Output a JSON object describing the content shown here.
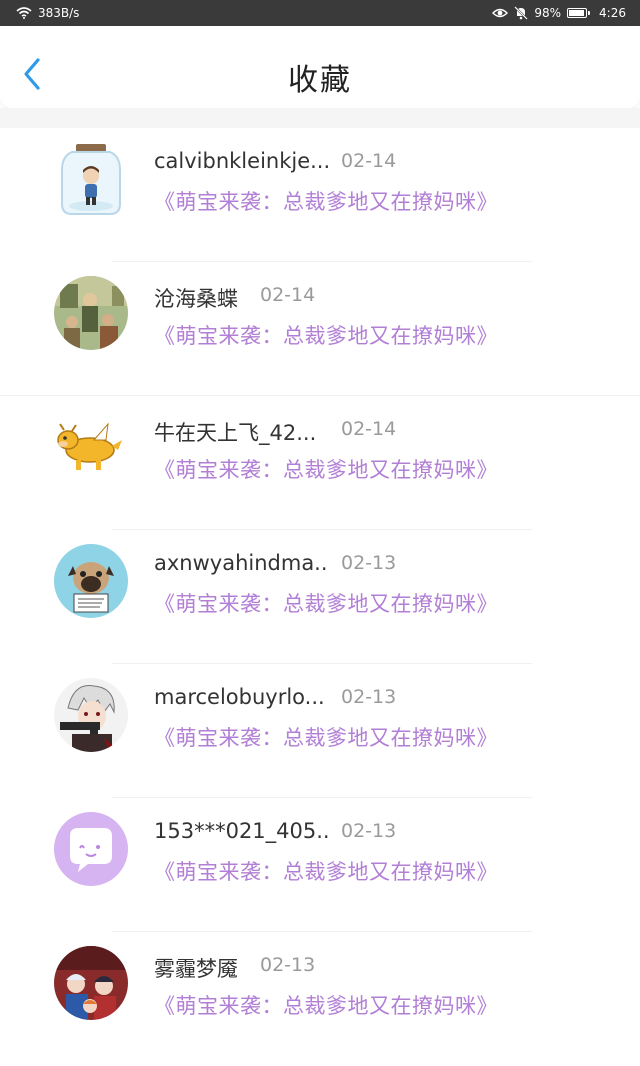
{
  "status_bar": {
    "speed": "383B/s",
    "battery": "98%",
    "time": "4:26"
  },
  "header": {
    "title": "收藏"
  },
  "items": [
    {
      "name": "calvibnkleinkje...",
      "date": "02-14",
      "book": "《萌宝来袭：总裁爹地又在撩妈咪》",
      "avatar": "jar-boy-avatar"
    },
    {
      "name": "沧海桑蝶",
      "date": "02-14",
      "book": "《萌宝来袭：总裁爹地又在撩妈咪》",
      "avatar": "painting-avatar"
    },
    {
      "name": "牛在天上飞_42...",
      "date": "02-14",
      "book": "《萌宝来袭：总裁爹地又在撩妈咪》",
      "avatar": "flying-cow-avatar"
    },
    {
      "name": "axnwyahindma..",
      "date": "02-13",
      "book": "《萌宝来袭：总裁爹地又在撩妈咪》",
      "avatar": "pug-avatar"
    },
    {
      "name": "marcelobuyrlo...",
      "date": "02-13",
      "book": "《萌宝来袭：总裁爹地又在撩妈咪》",
      "avatar": "anime-gunman-avatar"
    },
    {
      "name": "153***021_405..",
      "date": "02-13",
      "book": "《萌宝来袭：总裁爹地又在撩妈咪》",
      "avatar": "default-chat-avatar"
    },
    {
      "name": "雾霾梦魇",
      "date": "02-13",
      "book": "《萌宝来袭：总裁爹地又在撩妈咪》",
      "avatar": "anime-group-avatar"
    }
  ],
  "colors": {
    "accent": "#2f9ae8",
    "book_title": "#b27fd6",
    "date": "#9a9a9a",
    "name": "#333333"
  }
}
